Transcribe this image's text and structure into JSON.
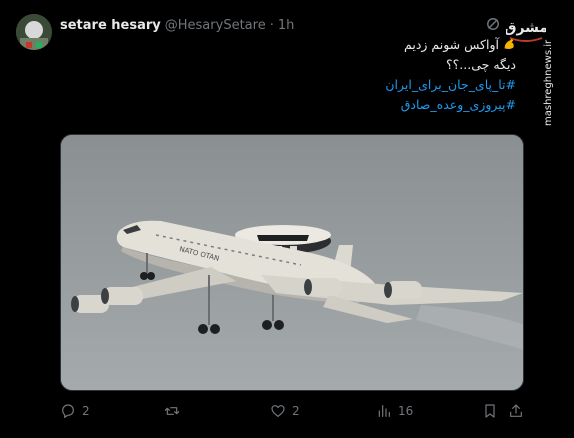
{
  "tweet": {
    "display_name": "setare hesary",
    "handle": "@HesarySetare",
    "separator": "·",
    "time": "1h",
    "lines": [
      "آواکس شونم زدیم",
      "دیگه چی...؟؟",
      "#تا_پای_جان_برای_ایران",
      "#پیروزی_وعده_صادق"
    ],
    "emoji_name": "flexed-biceps-icon"
  },
  "watermark": {
    "logo_text": "مشرق",
    "site": "mashreghnews.ir"
  },
  "actions": {
    "reply_count": "2",
    "retweet_count": "",
    "like_count": "2",
    "views_count": "16"
  },
  "colors": {
    "background": "#000000",
    "text": "#e7e9ea",
    "muted": "#71767b",
    "link": "#1d9bf0",
    "emoji": "#f4b400"
  }
}
